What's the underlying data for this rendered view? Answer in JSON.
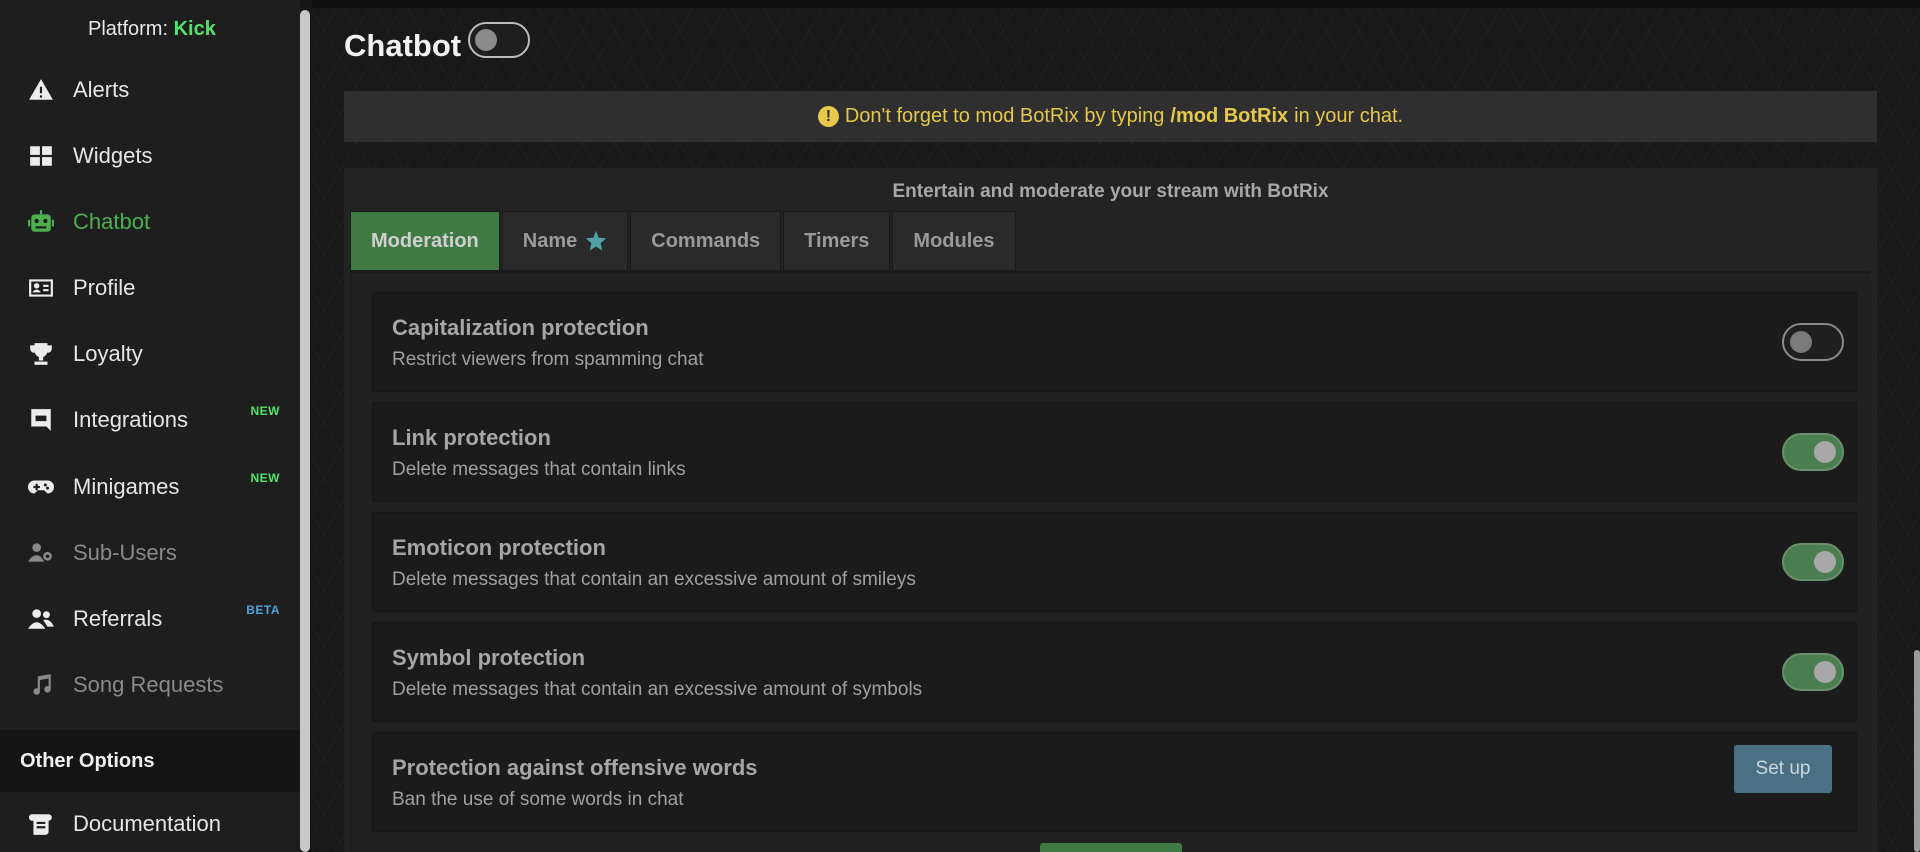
{
  "sidebar": {
    "platform_label": "Platform:",
    "platform_value": "Kick",
    "items": [
      {
        "label": "Alerts",
        "icon": "warning-triangle-icon"
      },
      {
        "label": "Widgets",
        "icon": "grid-icon"
      },
      {
        "label": "Chatbot",
        "icon": "robot-icon"
      },
      {
        "label": "Profile",
        "icon": "id-card-icon"
      },
      {
        "label": "Loyalty",
        "icon": "trophy-icon"
      },
      {
        "label": "Integrations",
        "icon": "discord-icon",
        "badge": "NEW"
      },
      {
        "label": "Minigames",
        "icon": "gamepad-icon",
        "badge": "NEW"
      },
      {
        "label": "Sub-Users",
        "icon": "users-cog-icon"
      },
      {
        "label": "Referrals",
        "icon": "users-icon",
        "badge": "BETA"
      },
      {
        "label": "Song Requests",
        "icon": "music-note-icon"
      }
    ],
    "section_title": "Other Options",
    "documentation_label": "Documentation"
  },
  "main": {
    "title": "Chatbot",
    "notice": {
      "prefix": "Don't forget to mod BotRix by typing",
      "command": "/mod BotRix",
      "suffix": "in your chat."
    },
    "panel_heading": "Entertain and moderate your stream with BotRix",
    "tabs": [
      {
        "label": "Moderation"
      },
      {
        "label": "Name"
      },
      {
        "label": "Commands"
      },
      {
        "label": "Timers"
      },
      {
        "label": "Modules"
      }
    ],
    "options": [
      {
        "title": "Capitalization protection",
        "desc": "Restrict viewers from spamming chat",
        "enabled": false
      },
      {
        "title": "Link protection",
        "desc": "Delete messages that contain links",
        "enabled": true
      },
      {
        "title": "Emoticon protection",
        "desc": "Delete messages that contain an excessive amount of smileys",
        "enabled": true
      },
      {
        "title": "Symbol protection",
        "desc": "Delete messages that contain an excessive amount of symbols",
        "enabled": true
      },
      {
        "title": "Protection against offensive words",
        "desc": "Ban the use of some words in chat",
        "button": "Set up"
      }
    ]
  },
  "colors": {
    "accent_green": "#4caf50",
    "kick_green": "#53e36a",
    "notice_yellow": "#e6c84a",
    "toggle_on": "#4a7d4f",
    "setup_button": "#4a7083"
  }
}
